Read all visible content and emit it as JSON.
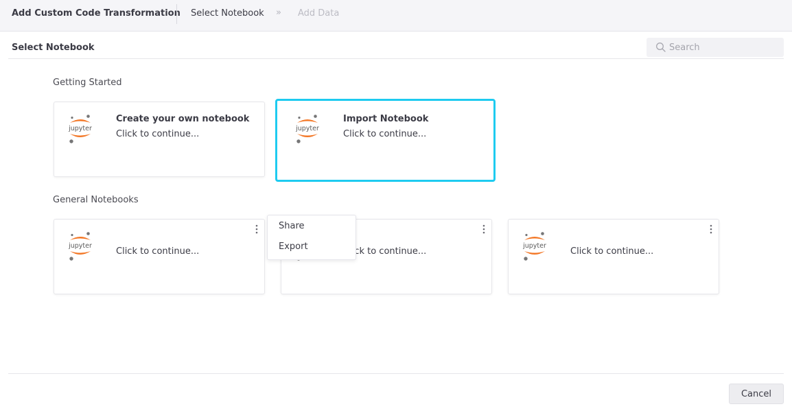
{
  "header": {
    "title": "Add Custom Code Transformation",
    "steps": [
      "Select Notebook",
      "Add Data"
    ],
    "separator": "»"
  },
  "section": {
    "title": "Select Notebook",
    "search_placeholder": "Search"
  },
  "getting_started": {
    "label": "Getting Started",
    "cards": [
      {
        "title": "Create your own notebook",
        "subtitle": "Click to continue...",
        "selected": false
      },
      {
        "title": "Import Notebook",
        "subtitle": "Click to continue...",
        "selected": true
      }
    ]
  },
  "general_notebooks": {
    "label": "General Notebooks",
    "cards": [
      {
        "title": "",
        "subtitle": "Click to continue..."
      },
      {
        "title": "",
        "subtitle": "Click to continue..."
      },
      {
        "title": "",
        "subtitle": "Click to continue..."
      }
    ]
  },
  "context_menu": {
    "items": [
      "Share",
      "Export"
    ]
  },
  "footer": {
    "cancel_label": "Cancel"
  },
  "colors": {
    "selected_border": "#1ecbf0",
    "jupyter_orange": "#f37726",
    "jupyter_gray": "#767677"
  },
  "icons": {
    "notebook_logo": "jupyter-logo-icon",
    "search": "search-icon",
    "card_menu": "kebab-menu-icon"
  }
}
